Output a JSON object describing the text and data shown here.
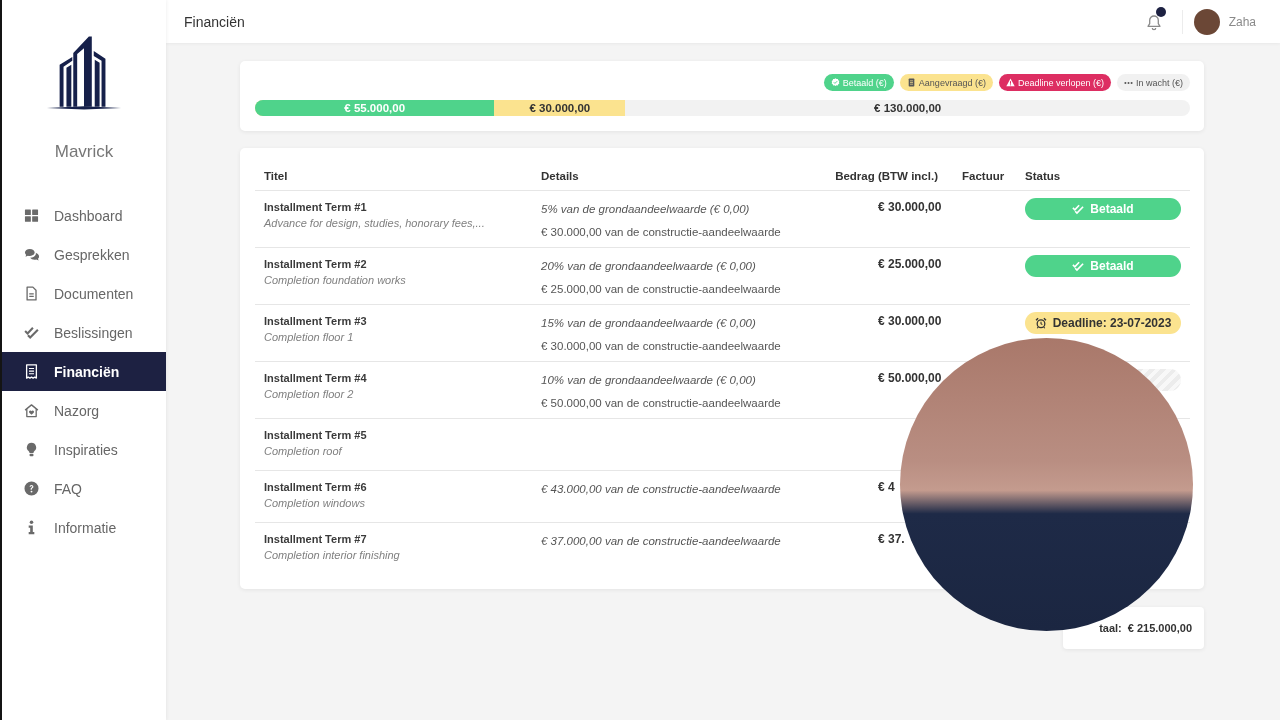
{
  "sidebar": {
    "brand": "Mavrick",
    "items": [
      {
        "label": "Dashboard",
        "selected": false
      },
      {
        "label": "Gesprekken",
        "selected": false
      },
      {
        "label": "Documenten",
        "selected": false
      },
      {
        "label": "Beslissingen",
        "selected": false
      },
      {
        "label": "Financiën",
        "selected": true
      },
      {
        "label": "Nazorg",
        "selected": false
      },
      {
        "label": "Inspiraties",
        "selected": false
      },
      {
        "label": "FAQ",
        "selected": false
      },
      {
        "label": "Informatie",
        "selected": false
      }
    ]
  },
  "header": {
    "title": "Financiën",
    "notification_unread": true,
    "user": "Zaha"
  },
  "summary": {
    "legend": [
      {
        "label": "Betaald (€)",
        "kind": "paid",
        "color": "#4fd38b"
      },
      {
        "label": "Aangevraagd (€)",
        "kind": "requested",
        "color": "#fbe38f"
      },
      {
        "label": "Deadline verlopen (€)",
        "kind": "expired",
        "color": "#dd2e62"
      },
      {
        "label": "In wacht (€)",
        "kind": "waiting",
        "color": "#f1f1f1"
      }
    ],
    "progress": {
      "segments": [
        {
          "label": "€ 55.000,00",
          "level": 0.256,
          "color": "#4fd38b"
        },
        {
          "label": "€ 30.000,00",
          "level": 0.396,
          "color": "#fbe38f"
        }
      ],
      "rest_label": "€ 130.000,00"
    }
  },
  "table": {
    "columns": [
      "Titel",
      "Details",
      "Bedrag (BTW incl.)",
      "Factuur",
      "Status"
    ],
    "rows": [
      {
        "title": "Installment Term #1",
        "subtitle": "Advance for design, studies, honorary fees,...",
        "details": [
          {
            "text": "5% van de grondaandeelwaarde (€ 0,00)",
            "italic": true
          },
          {
            "text": "€ 30.000,00 van de constructie-aandeelwaarde",
            "italic": false
          }
        ],
        "amount": "€ 30.000,00",
        "status": {
          "kind": "paid",
          "label": "Betaald"
        }
      },
      {
        "title": "Installment Term #2",
        "subtitle": "Completion foundation works",
        "details": [
          {
            "text": "20% van de grondaandeelwaarde (€ 0,00)",
            "italic": true
          },
          {
            "text": "€ 25.000,00 van de constructie-aandeelwaarde",
            "italic": false
          }
        ],
        "amount": "€ 25.000,00",
        "status": {
          "kind": "paid",
          "label": "Betaald"
        }
      },
      {
        "title": "Installment Term #3",
        "subtitle": "Completion floor 1",
        "details": [
          {
            "text": "15% van de grondaandeelwaarde (€ 0,00)",
            "italic": true
          },
          {
            "text": "€ 30.000,00 van de constructie-aandeelwaarde",
            "italic": false
          }
        ],
        "amount": "€ 30.000,00",
        "status": {
          "kind": "deadline",
          "label": "Deadline: 23-07-2023"
        }
      },
      {
        "title": "Installment Term #4",
        "subtitle": "Completion floor 2",
        "details": [
          {
            "text": "10% van de grondaandeelwaarde (€ 0,00)",
            "italic": true
          },
          {
            "text": "€ 50.000,00 van de constructie-aandeelwaarde",
            "italic": false
          }
        ],
        "amount": "€ 50.000,00",
        "status": {
          "kind": "waiting"
        }
      },
      {
        "title": "Installment Term #5",
        "subtitle": "Completion roof"
      },
      {
        "title": "Installment Term #6",
        "subtitle": "Completion windows",
        "details": [
          {
            "text": "€ 43.000,00 van de constructie-aandeelwaarde",
            "italic": true
          }
        ],
        "amount": "€ 4"
      },
      {
        "title": "Installment Term #7",
        "subtitle": "Completion interior finishing",
        "details": [
          {
            "text": "€ 37.000,00 van de constructie-aandeelwaarde",
            "italic": true
          }
        ],
        "amount": "€ 37."
      }
    ]
  },
  "total": {
    "label": "taal:",
    "value": "€ 215.000,00"
  },
  "video_overlay": {
    "shown": true
  }
}
